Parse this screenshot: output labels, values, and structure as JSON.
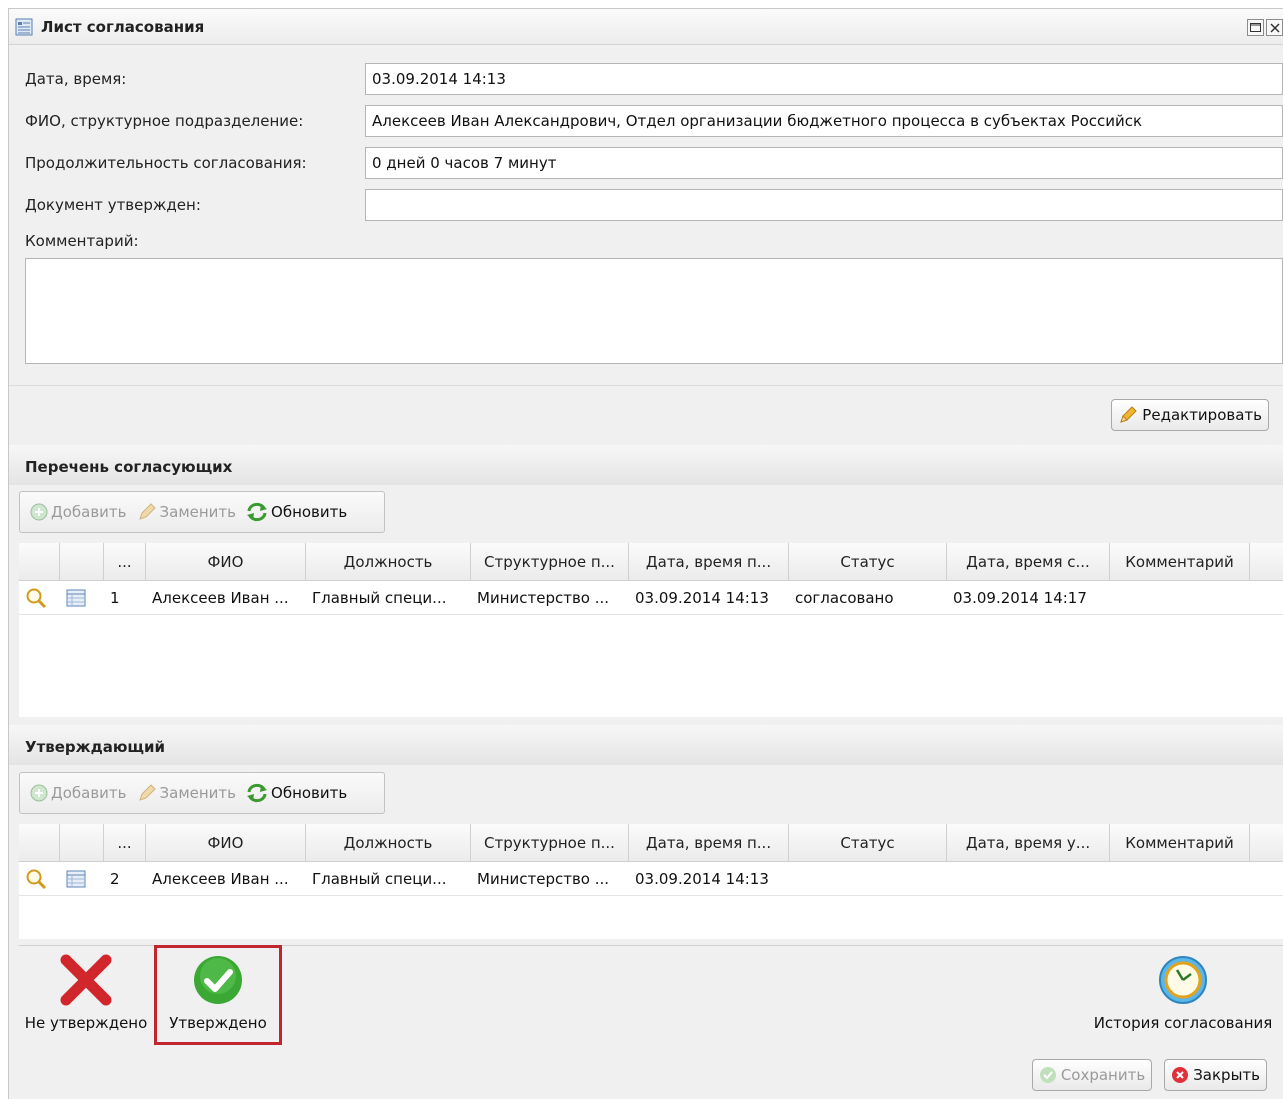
{
  "window": {
    "title": "Лист согласования"
  },
  "form": {
    "date_label": "Дата, время:",
    "date_value": "03.09.2014 14:13",
    "fio_label": "ФИО, структурное подразделение:",
    "fio_value": "Алексеев Иван Александрович, Отдел организации бюджетного процесса в субъектах Российск",
    "duration_label": "Продолжительность согласования:",
    "duration_value": "0 дней 0 часов 7 минут",
    "approved_label": "Документ утвержден:",
    "approved_value": "",
    "comment_label": "Комментарий:",
    "comment_value": "",
    "edit_button": "Редактировать"
  },
  "approvers": {
    "title": "Перечень согласующих",
    "toolbar": {
      "add": "Добавить",
      "replace": "Заменить",
      "refresh": "Обновить"
    },
    "columns": [
      "...",
      "ФИО",
      "Должность",
      "Структурное п...",
      "Дата, время п...",
      "Статус",
      "Дата, время с...",
      "Комментарий"
    ],
    "rows": [
      {
        "num": "1",
        "fio": "Алексеев Иван ...",
        "position": "Главный специ...",
        "structure": "Министерство ...",
        "date_received": "03.09.2014 14:13",
        "status": "согласовано",
        "date_done": "03.09.2014 14:17",
        "comment": ""
      }
    ]
  },
  "approver": {
    "title": "Утверждающий",
    "toolbar": {
      "add": "Добавить",
      "replace": "Заменить",
      "refresh": "Обновить"
    },
    "columns": [
      "...",
      "ФИО",
      "Должность",
      "Структурное п...",
      "Дата, время п...",
      "Статус",
      "Дата, время у...",
      "Комментарий"
    ],
    "rows": [
      {
        "num": "2",
        "fio": "Алексеев Иван ...",
        "position": "Главный специ...",
        "structure": "Министерство ...",
        "date_received": "03.09.2014 14:13",
        "status": "",
        "date_done": "",
        "comment": ""
      }
    ]
  },
  "actions": {
    "reject": "Не утверждено",
    "approve": "Утверждено",
    "history": "История согласования",
    "save": "Сохранить",
    "close": "Закрыть"
  },
  "colors": {
    "highlight": "#c0262d",
    "approve_green": "#3aa832",
    "reject_red": "#d0262c"
  }
}
